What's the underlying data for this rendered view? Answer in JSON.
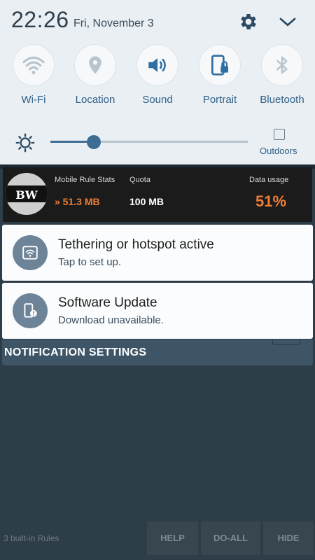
{
  "status": {
    "time": "22:26",
    "date": "Fri, November 3"
  },
  "quick_settings": {
    "tiles": [
      {
        "label": "Wi-Fi",
        "icon": "wifi-icon"
      },
      {
        "label": "Location",
        "icon": "location-icon"
      },
      {
        "label": "Sound",
        "icon": "sound-icon"
      },
      {
        "label": "Portrait",
        "icon": "portrait-lock-icon"
      },
      {
        "label": "Bluetooth",
        "icon": "bluetooth-icon"
      }
    ],
    "brightness_level": 0.22,
    "outdoors_label": "Outdoors",
    "outdoors_checked": false
  },
  "stats_widget": {
    "logo_text": "BW",
    "title": "Mobile Rule Stats",
    "used_value": "» 51.3 MB",
    "quota_title": "Quota",
    "quota_value": "100 MB",
    "usage_title": "Data usage",
    "usage_value": "51%"
  },
  "notifications": [
    {
      "title": "Tethering or hotspot active",
      "text": "Tap to set up.",
      "icon": "hotspot-icon"
    },
    {
      "title": "Software Update",
      "text": "Download unavailable.",
      "icon": "phone-alert-icon"
    }
  ],
  "notification_settings_label": "NOTIFICATION SETTINGS",
  "bottom_bar": {
    "rules_text": "3 built-in Rules",
    "buttons": [
      "HELP",
      "DO-ALL",
      "HIDE"
    ]
  },
  "colors": {
    "accent": "#3d6c95",
    "usage_orange": "#f07d35",
    "panel_bg": "#e9eff3",
    "notif_icon_bg": "#6d8397"
  }
}
